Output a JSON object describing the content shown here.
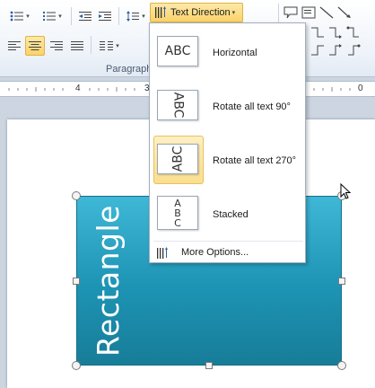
{
  "ribbon": {
    "group_label": "Paragraph",
    "text_direction_button": {
      "label": "Text Direction",
      "icon": "text-direction-icon"
    },
    "icons": [
      "bullets-icon",
      "numbering-icon",
      "decrease-indent-icon",
      "increase-indent-icon",
      "line-spacing-icon",
      "align-left-icon",
      "align-center-icon",
      "align-right-icon",
      "justify-icon",
      "columns-icon",
      "shape-callout-icon",
      "shape-textbox-icon",
      "shape-line-icon",
      "shape-arrow-icon"
    ],
    "selected": "align-center-icon"
  },
  "ruler": {
    "left_label": "4",
    "right_label": "0"
  },
  "text_direction_menu": {
    "items": [
      {
        "label": "Horizontal",
        "preview": "ABC",
        "orientation": "horizontal"
      },
      {
        "label": "Rotate all text 90°",
        "preview": "ABC",
        "orientation": "rotate-90"
      },
      {
        "label": "Rotate all text 270°",
        "preview": "ABC",
        "orientation": "rotate-270",
        "selected": true
      },
      {
        "label": "Stacked",
        "preview": [
          "A",
          "B",
          "C"
        ],
        "orientation": "stacked"
      }
    ],
    "more_options": "More Options..."
  },
  "shape": {
    "text": "Rectangle",
    "fill": "#2aa3c4"
  },
  "colors": {
    "highlight": "#fbd26a",
    "shape_fill": "#2aa3c4"
  }
}
